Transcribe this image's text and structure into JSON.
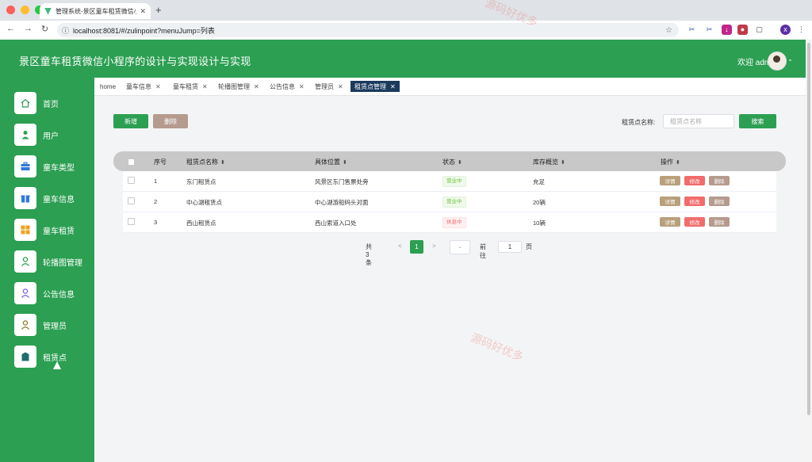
{
  "browser": {
    "tab_title": "管理系统-景区童车租赁微信小...",
    "url": "localhost:8081/#/zulinpoint?menuJump=列表"
  },
  "header": {
    "title": "景区童车租赁微信小程序的设计与实现设计与实现",
    "welcome": "欢迎 admin"
  },
  "sidebar": {
    "items": [
      {
        "label": "首页",
        "icon": "home-icon",
        "color": "#2c9f52"
      },
      {
        "label": "用户",
        "icon": "user-icon",
        "color": "#2c9f52"
      },
      {
        "label": "童车类型",
        "icon": "briefcase-icon",
        "color": "#2f7ad8"
      },
      {
        "label": "童车信息",
        "icon": "gift-icon",
        "color": "#2f7ad8"
      },
      {
        "label": "童车租赁",
        "icon": "grid-icon",
        "color": "#f0a020"
      },
      {
        "label": "轮播图管理",
        "icon": "person-icon",
        "color": "#2c9f52"
      },
      {
        "label": "公告信息",
        "icon": "person-icon",
        "color": "#7a5fd8"
      },
      {
        "label": "管理员",
        "icon": "person-icon",
        "color": "#8a7a2a"
      },
      {
        "label": "租赁点",
        "icon": "location-icon",
        "color": "#1f6d6d"
      }
    ]
  },
  "page_tabs": [
    "home",
    "童车信息",
    "童车租赁",
    "轮播图管理",
    "公告信息",
    "管理员",
    "租赁点管理"
  ],
  "toolbar": {
    "add_label": "新增",
    "delete_label": "删除",
    "search_label": "租赁点名称:",
    "search_placeholder": "租赁点名称",
    "search_button": "搜索"
  },
  "table": {
    "columns": [
      "序号",
      "租赁点名称",
      "具体位置",
      "状态",
      "库存概览",
      "操作"
    ],
    "rows": [
      {
        "index": "1",
        "name": "东门租赁点",
        "location": "风景区东门售票处旁",
        "status": "营业中",
        "stock": "充足"
      },
      {
        "index": "2",
        "name": "中心湖租赁点",
        "location": "中心湖游船码头对面",
        "status": "营业中",
        "stock": "20辆"
      },
      {
        "index": "3",
        "name": "西山租赁点",
        "location": "西山索道入口处",
        "status": "休息中",
        "stock": "10辆"
      }
    ],
    "actions": {
      "detail": "详情",
      "edit": "修改",
      "delete": "删除"
    }
  },
  "pagination": {
    "total": "共 3 条",
    "prev": "<",
    "current": "1",
    "next": ">",
    "goto": "前往",
    "goto_value": "1",
    "page_suffix": "页"
  },
  "watermark": "源码好优多",
  "colors": {
    "primary": "#2c9f52",
    "delete_btn": "#b59a8e",
    "detail_btn": "#b8a07a",
    "edit_btn": "#f26c6c",
    "row_delete_btn": "#b59a8e",
    "active_tab": "#1b3a5e"
  }
}
